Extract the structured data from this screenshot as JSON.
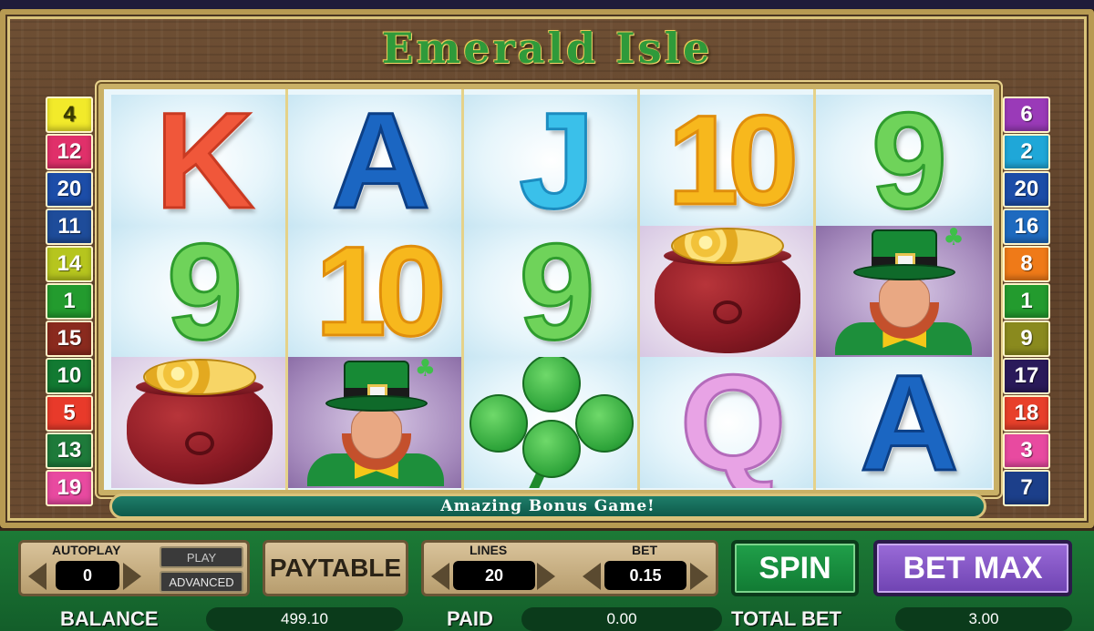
{
  "game": {
    "title": "Emerald Isle"
  },
  "line_numbers": {
    "left": [
      {
        "n": "4",
        "color": "#f2ea2a",
        "text_color": "#3a3a00"
      },
      {
        "n": "12",
        "color": "#e0306a",
        "text_color": "#ffffff"
      },
      {
        "n": "20",
        "color": "#1c4da8",
        "text_color": "#ffffff"
      },
      {
        "n": "11",
        "color": "#1e4c9a",
        "text_color": "#ffffff"
      },
      {
        "n": "14",
        "color": "#b6c51e",
        "text_color": "#ffffff"
      },
      {
        "n": "1",
        "color": "#239b2e",
        "text_color": "#ffffff"
      },
      {
        "n": "15",
        "color": "#8a2a1e",
        "text_color": "#ffffff"
      },
      {
        "n": "10",
        "color": "#127a32",
        "text_color": "#ffffff"
      },
      {
        "n": "5",
        "color": "#e83a2a",
        "text_color": "#ffffff"
      },
      {
        "n": "13",
        "color": "#1e7a3a",
        "text_color": "#ffffff"
      },
      {
        "n": "19",
        "color": "#e84aa0",
        "text_color": "#ffffff"
      }
    ],
    "right": [
      {
        "n": "6",
        "color": "#9a3ab8",
        "text_color": "#ffffff"
      },
      {
        "n": "2",
        "color": "#1fa7d8",
        "text_color": "#ffffff"
      },
      {
        "n": "20",
        "color": "#1c4da8",
        "text_color": "#ffffff"
      },
      {
        "n": "16",
        "color": "#1e6abf",
        "text_color": "#ffffff"
      },
      {
        "n": "8",
        "color": "#ef7a18",
        "text_color": "#ffffff"
      },
      {
        "n": "1",
        "color": "#239b2e",
        "text_color": "#ffffff"
      },
      {
        "n": "9",
        "color": "#8a8a1e",
        "text_color": "#ffffff"
      },
      {
        "n": "17",
        "color": "#2a1a5a",
        "text_color": "#ffffff"
      },
      {
        "n": "18",
        "color": "#e8402a",
        "text_color": "#ffffff"
      },
      {
        "n": "3",
        "color": "#e84aa0",
        "text_color": "#ffffff"
      },
      {
        "n": "7",
        "color": "#1c3f8a",
        "text_color": "#ffffff"
      }
    ]
  },
  "reels": [
    [
      {
        "symbol": "K",
        "cls": "k"
      },
      {
        "symbol": "9",
        "cls": "nine"
      },
      {
        "symbol": "pot-of-gold",
        "cls": "pot"
      }
    ],
    [
      {
        "symbol": "A",
        "cls": "a"
      },
      {
        "symbol": "10",
        "cls": "ten"
      },
      {
        "symbol": "leprechaun",
        "cls": "lep"
      }
    ],
    [
      {
        "symbol": "J",
        "cls": "j"
      },
      {
        "symbol": "9",
        "cls": "nine"
      },
      {
        "symbol": "clover",
        "cls": "clover"
      }
    ],
    [
      {
        "symbol": "10",
        "cls": "ten"
      },
      {
        "symbol": "pot-of-gold",
        "cls": "pot"
      },
      {
        "symbol": "Q",
        "cls": "q"
      }
    ],
    [
      {
        "symbol": "9",
        "cls": "nine"
      },
      {
        "symbol": "leprechaun",
        "cls": "lep"
      },
      {
        "symbol": "A",
        "cls": "a"
      }
    ]
  ],
  "message": "Amazing Bonus Game!",
  "autoplay": {
    "label": "AUTOPLAY",
    "value": "0",
    "play_label": "PLAY",
    "advanced_label": "ADVANCED"
  },
  "paytable_label": "PAYTABLE",
  "lines": {
    "label": "LINES",
    "value": "20"
  },
  "bet": {
    "label": "BET",
    "value": "0.15"
  },
  "spin_label": "SPIN",
  "betmax_label": "BET MAX",
  "balance": {
    "label": "BALANCE",
    "value": "499.10"
  },
  "paid": {
    "label": "PAID",
    "value": "0.00"
  },
  "total_bet": {
    "label": "TOTAL BET",
    "value": "3.00"
  }
}
